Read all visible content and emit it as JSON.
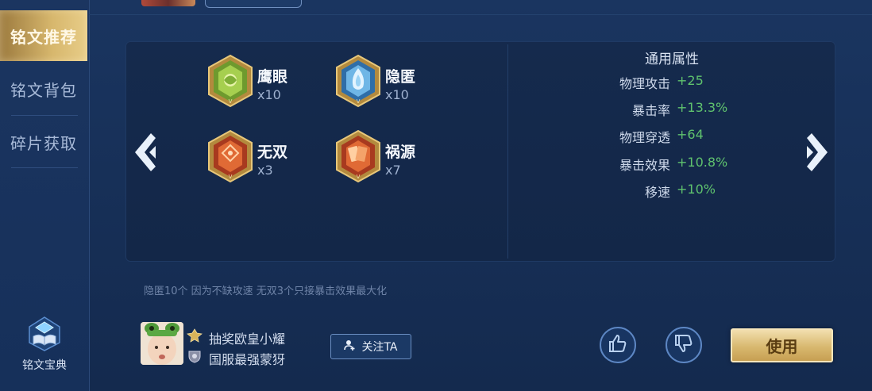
{
  "sidebar": {
    "items": [
      {
        "label": "铭文推荐",
        "active": true
      },
      {
        "label": "铭文背包",
        "active": false
      },
      {
        "label": "碎片获取",
        "active": false
      }
    ],
    "codex_label": "铭文宝典"
  },
  "inscriptions": [
    {
      "name": "鹰眼",
      "count": "x10",
      "icon": "green-hexagon-inscription-icon"
    },
    {
      "name": "隐匿",
      "count": "x10",
      "icon": "blue-hexagon-inscription-icon"
    },
    {
      "name": "无双",
      "count": "x3",
      "icon": "red-hexagon-inscription-icon"
    },
    {
      "name": "祸源",
      "count": "x7",
      "icon": "red-hexagon-inscription-icon"
    }
  ],
  "attributes": {
    "title": "通用属性",
    "rows": [
      {
        "name": "物理攻击",
        "value": "+25"
      },
      {
        "name": "暴击率",
        "value": "+13.3%"
      },
      {
        "name": "物理穿透",
        "value": "+64"
      },
      {
        "name": "暴击效果",
        "value": "+10.8%"
      },
      {
        "name": "移速",
        "value": "+10%"
      }
    ]
  },
  "note": "隐匿10个 因为不缺攻速 无双3个只接暴击效果最大化",
  "author": {
    "title": "抽奖欧皇小耀",
    "rank": "国服最强蒙犽"
  },
  "buttons": {
    "follow": "关注TA",
    "use": "使用"
  },
  "colors": {
    "accent_gold": "#d7b76d",
    "value_green": "#5fc26e",
    "background": "#173058"
  }
}
